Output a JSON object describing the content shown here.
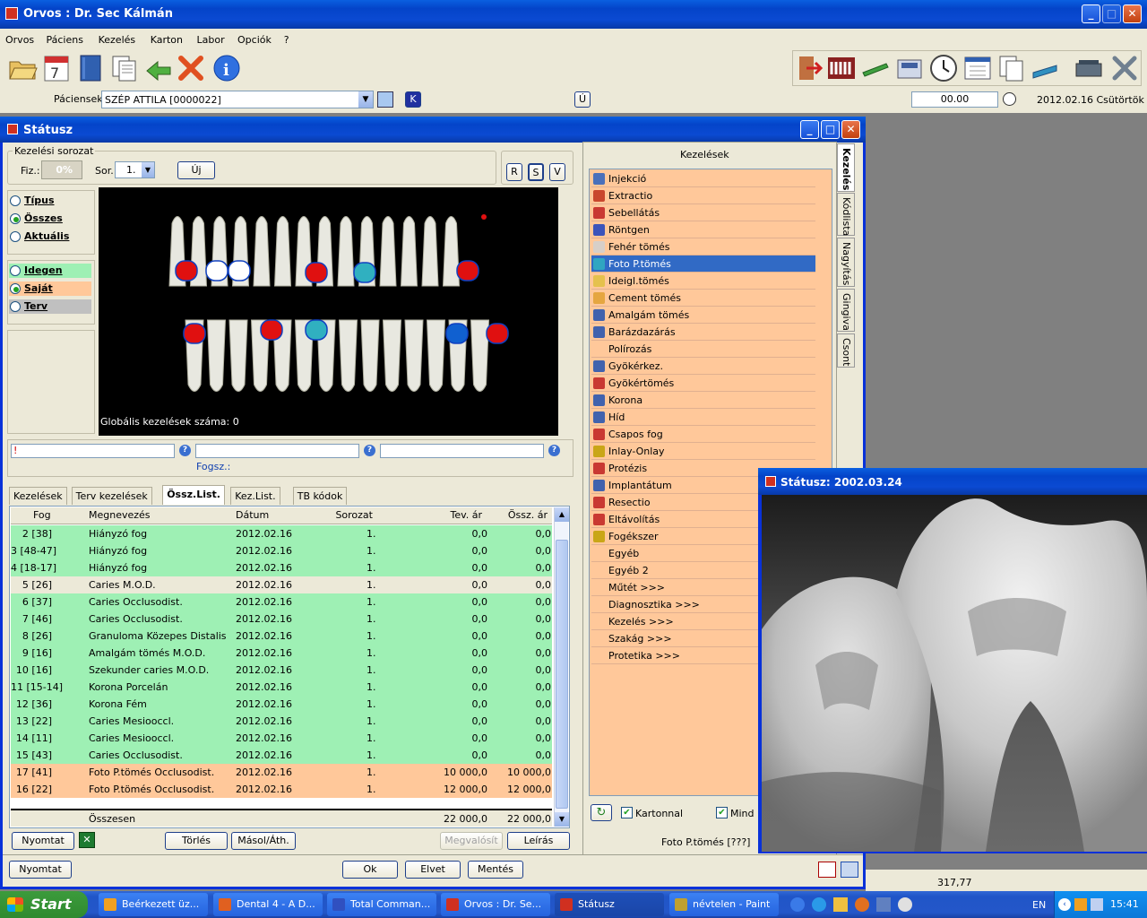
{
  "main_window": {
    "title": "Orvos : Dr. Sec Kálmán",
    "menu": [
      "Orvos",
      "Páciens",
      "Kezelés",
      "Karton",
      "Labor",
      "Opciók",
      "?"
    ],
    "patient_label": "Páciensek:",
    "patient_value": "SZÉP ATTILA [0000022]",
    "k_button": "K",
    "u_button": "Ú",
    "time_value": "00.00",
    "date_text": "2012.02.16 Csütörtök",
    "status_value": "317,77"
  },
  "status_window": {
    "title": "Státusz",
    "series_group": "Kezelési sorozat",
    "fiz_label": "Fiz.:",
    "fiz_value": "0%",
    "sor_label": "Sor.",
    "sor_value": "1.",
    "new_button": "Új",
    "view_buttons": [
      "R",
      "S",
      "V"
    ],
    "radio_group1": [
      {
        "label": "Típus",
        "checked": false
      },
      {
        "label": "Összes",
        "checked": true
      },
      {
        "label": "Aktuális",
        "checked": false
      }
    ],
    "radio_group2": [
      {
        "label": "Idegen",
        "checked": false,
        "color": "#9ef0b4"
      },
      {
        "label": "Saját",
        "checked": true,
        "color": "#ffc89a"
      },
      {
        "label": "Terv",
        "checked": false,
        "color": "#c0c0c0"
      }
    ],
    "global_count": "Globális kezelések száma: 0",
    "field1_value": "!",
    "fogsz_label": "Fogsz.:",
    "tabs": [
      "Kezelések",
      "Terv kezelések",
      "Össz.List.",
      "Kez.List.",
      "TB kódok"
    ],
    "active_tab": "Össz.List.",
    "columns": [
      "Fog",
      "Megnevezés",
      "Dátum",
      "Sorozat",
      "Tev. ár",
      "Össz. ár"
    ],
    "rows": [
      {
        "fog": "2 [38]",
        "name": "Hiányzó fog",
        "date": "2012.02.16",
        "series": "1.",
        "tev": "0,0",
        "ossz": "0,0",
        "color": "#9ef0b4"
      },
      {
        "fog": "3 [48-47]",
        "name": "Hiányzó fog",
        "date": "2012.02.16",
        "series": "1.",
        "tev": "0,0",
        "ossz": "0,0",
        "color": "#9ef0b4"
      },
      {
        "fog": "4 [18-17]",
        "name": "Hiányzó fog",
        "date": "2012.02.16",
        "series": "1.",
        "tev": "0,0",
        "ossz": "0,0",
        "color": "#9ef0b4"
      },
      {
        "fog": "5 [26]",
        "name": "Caries M.O.D.",
        "date": "2012.02.16",
        "series": "1.",
        "tev": "0,0",
        "ossz": "0,0",
        "color": "#ece9d8"
      },
      {
        "fog": "6 [37]",
        "name": "Caries Occlusodist.",
        "date": "2012.02.16",
        "series": "1.",
        "tev": "0,0",
        "ossz": "0,0",
        "color": "#9ef0b4"
      },
      {
        "fog": "7 [46]",
        "name": "Caries Occlusodist.",
        "date": "2012.02.16",
        "series": "1.",
        "tev": "0,0",
        "ossz": "0,0",
        "color": "#9ef0b4"
      },
      {
        "fog": "8 [26]",
        "name": "Granuloma Közepes Distalis",
        "date": "2012.02.16",
        "series": "1.",
        "tev": "0,0",
        "ossz": "0,0",
        "color": "#9ef0b4"
      },
      {
        "fog": "9 [16]",
        "name": "Amalgám tömés M.O.D.",
        "date": "2012.02.16",
        "series": "1.",
        "tev": "0,0",
        "ossz": "0,0",
        "color": "#9ef0b4"
      },
      {
        "fog": "10 [16]",
        "name": "Szekunder caries M.O.D.",
        "date": "2012.02.16",
        "series": "1.",
        "tev": "0,0",
        "ossz": "0,0",
        "color": "#9ef0b4"
      },
      {
        "fog": "11 [15-14]",
        "name": "Korona Porcelán",
        "date": "2012.02.16",
        "series": "1.",
        "tev": "0,0",
        "ossz": "0,0",
        "color": "#9ef0b4"
      },
      {
        "fog": "12 [36]",
        "name": "Korona Fém",
        "date": "2012.02.16",
        "series": "1.",
        "tev": "0,0",
        "ossz": "0,0",
        "color": "#9ef0b4"
      },
      {
        "fog": "13 [22]",
        "name": "Caries Mesiooccl.",
        "date": "2012.02.16",
        "series": "1.",
        "tev": "0,0",
        "ossz": "0,0",
        "color": "#9ef0b4"
      },
      {
        "fog": "14 [11]",
        "name": "Caries Mesiooccl.",
        "date": "2012.02.16",
        "series": "1.",
        "tev": "0,0",
        "ossz": "0,0",
        "color": "#9ef0b4"
      },
      {
        "fog": "15 [43]",
        "name": "Caries Occlusodist.",
        "date": "2012.02.16",
        "series": "1.",
        "tev": "0,0",
        "ossz": "0,0",
        "color": "#9ef0b4"
      },
      {
        "fog": "17 [41]",
        "name": "Foto P.tömés Occlusodist.",
        "date": "2012.02.16",
        "series": "1.",
        "tev": "10 000,0",
        "ossz": "10 000,0",
        "color": "#ffc89a"
      },
      {
        "fog": "16 [22]",
        "name": "Foto P.tömés Occlusodist.",
        "date": "2012.02.16",
        "series": "1.",
        "tev": "12 000,0",
        "ossz": "12 000,0",
        "color": "#ffc89a"
      }
    ],
    "total_label": "Összesen",
    "total_tev": "22 000,0",
    "total_ossz": "22 000,0",
    "bottom_buttons": [
      "Nyomtat",
      "Törlés",
      "Másol/Áth.",
      "Megvalósít",
      "Leírás"
    ],
    "footer_buttons": [
      "Nyomtat",
      "Ok",
      "Elvet",
      "Mentés"
    ],
    "treat_header": "Kezelések",
    "treatments": [
      {
        "label": "Injekció",
        "icon": "syringe-icon",
        "color": "#2a60c0"
      },
      {
        "label": "Extractio",
        "icon": "extraction-icon",
        "color": "#c0301a"
      },
      {
        "label": "Sebellátás",
        "icon": "wound-care-icon",
        "color": "#c02020"
      },
      {
        "label": "Röntgen",
        "icon": "xray-icon",
        "color": "#1a3fc0"
      },
      {
        "label": "Fehér tömés",
        "icon": "white-filling-icon",
        "color": "#d0d0d0"
      },
      {
        "label": "Foto P.tömés",
        "icon": "photo-filling-icon",
        "color": "#30b0c0"
      },
      {
        "label": "Ideigl.tömés",
        "icon": "temp-filling-icon",
        "color": "#e0c040"
      },
      {
        "label": "Cement tömés",
        "icon": "cement-filling-icon",
        "color": "#e0a030"
      },
      {
        "label": "Amalgám tömés",
        "icon": "amalgam-filling-icon",
        "color": "#2050b0"
      },
      {
        "label": "Barázdazárás",
        "icon": "sealant-icon",
        "color": "#2050b0"
      },
      {
        "label": "Polírozás",
        "icon": "",
        "color": ""
      },
      {
        "label": "Gyökérkez.",
        "icon": "root-treatment-icon",
        "color": "#2050b0"
      },
      {
        "label": "Gyökértömés",
        "icon": "root-filling-icon",
        "color": "#c02020"
      },
      {
        "label": "Korona",
        "icon": "crown-icon",
        "color": "#2050b0"
      },
      {
        "label": "Híd",
        "icon": "bridge-icon",
        "color": "#2050b0"
      },
      {
        "label": "Csapos fog",
        "icon": "post-tooth-icon",
        "color": "#c02020"
      },
      {
        "label": "Inlay-Onlay",
        "icon": "inlay-icon",
        "color": "#c0a000"
      },
      {
        "label": "Protézis",
        "icon": "denture-icon",
        "color": "#c02020"
      },
      {
        "label": "Implantátum",
        "icon": "implant-icon",
        "color": "#2050b0"
      },
      {
        "label": "Resectio",
        "icon": "resection-icon",
        "color": "#c02020"
      },
      {
        "label": "Eltávolítás",
        "icon": "removal-icon",
        "color": "#c02020"
      },
      {
        "label": "Fogékszer",
        "icon": "jewel-icon",
        "color": "#c0a000"
      },
      {
        "label": "Egyéb",
        "icon": "",
        "color": ""
      },
      {
        "label": "Egyéb 2",
        "icon": "",
        "color": ""
      },
      {
        "label": "Műtét >>>",
        "icon": "",
        "color": ""
      },
      {
        "label": "Diagnosztika >>>",
        "icon": "",
        "color": ""
      },
      {
        "label": "Kezelés >>>",
        "icon": "",
        "color": ""
      },
      {
        "label": "Szakág >>>",
        "icon": "",
        "color": ""
      },
      {
        "label": "Protetika >>>",
        "icon": "",
        "color": ""
      }
    ],
    "selected_treatment": "Foto P.tömés",
    "side_tabs": [
      "Kezelés",
      "Kódlista",
      "Nagyítás",
      "Gingiva",
      "Csont"
    ],
    "kartonnal_label": "Kartonnal",
    "mind_label": "Mind",
    "bottom_status": "Foto P.tömés [???]"
  },
  "xray_window": {
    "title": "Státusz: 2002.03.24"
  },
  "taskbar": {
    "start": "Start",
    "items": [
      {
        "label": "Beérkezett üz...",
        "active": false
      },
      {
        "label": "Dental 4 - A D...",
        "active": false
      },
      {
        "label": "Total Comman...",
        "active": false
      },
      {
        "label": "Orvos : Dr. Se...",
        "active": false
      },
      {
        "label": "Státusz",
        "active": true
      },
      {
        "label": "névtelen - Paint",
        "active": false
      }
    ],
    "lang": "EN",
    "clock": "15:41"
  }
}
